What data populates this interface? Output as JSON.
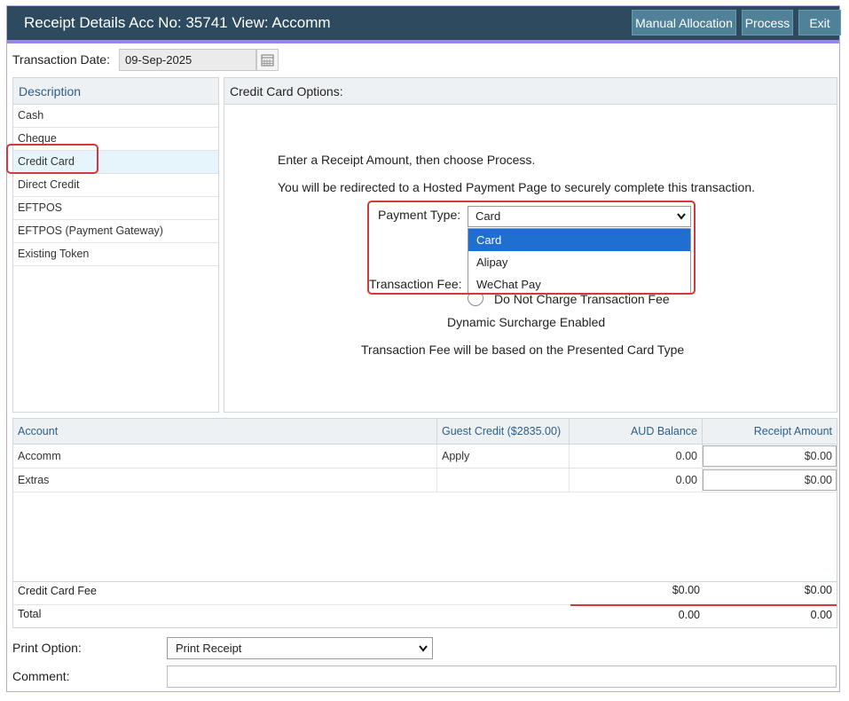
{
  "window": {
    "title": "Receipt Details Acc No: 35741 View: Accomm",
    "buttons": {
      "manual_allocation": "Manual Allocation",
      "process": "Process",
      "exit": "Exit"
    }
  },
  "transaction_date": {
    "label": "Transaction Date:",
    "value": "09-Sep-2025"
  },
  "description": {
    "header": "Description",
    "items": [
      "Cash",
      "Cheque",
      "Credit Card",
      "Direct Credit",
      "EFTPOS",
      "EFTPOS (Payment Gateway)",
      "Existing Token"
    ],
    "selected": "Credit Card"
  },
  "credit_card": {
    "header": "Credit Card Options:",
    "line1": "Enter a Receipt Amount, then choose Process.",
    "line2": "You will be redirected to a Hosted Payment Page to securely complete this transaction.",
    "payment_type_label": "Payment Type:",
    "payment_type_value": "Card",
    "payment_type_options": [
      "Card",
      "Alipay",
      "WeChat Pay"
    ],
    "transaction_fee_label": "Transaction Fee:",
    "no_charge_label": "Do Not Charge Transaction Fee",
    "dynamic": "Dynamic Surcharge Enabled",
    "fee_note": "Transaction Fee will be based on the Presented Card Type"
  },
  "accounts": {
    "headers": [
      "Account",
      "Guest Credit ($2835.00)",
      "AUD Balance",
      "Receipt Amount"
    ],
    "rows": [
      {
        "account": "Accomm",
        "guest_credit": "Apply",
        "balance": "0.00",
        "receipt": "$0.00"
      },
      {
        "account": "Extras",
        "guest_credit": "",
        "balance": "0.00",
        "receipt": "$0.00"
      }
    ],
    "fee_row": {
      "label": "Credit Card Fee",
      "balance": "$0.00",
      "receipt": "$0.00"
    },
    "total_row": {
      "label": "Total",
      "balance": "0.00",
      "receipt": "0.00"
    }
  },
  "print_option": {
    "label": "Print Option:",
    "value": "Print Receipt"
  },
  "comment": {
    "label": "Comment:",
    "value": ""
  },
  "colors": {
    "titlebar": "#2d4a5f",
    "accent": "#9b86e6",
    "highlight": "#1f6fd1",
    "callout": "#d13a3a"
  }
}
